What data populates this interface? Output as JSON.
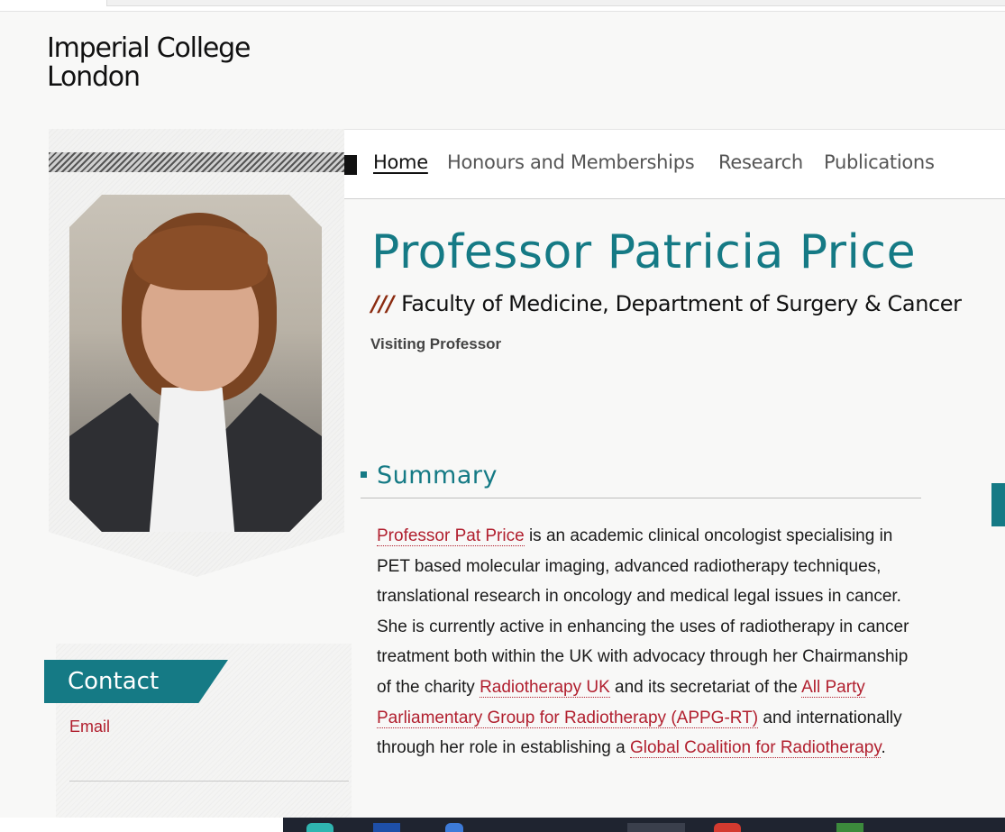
{
  "logo": {
    "line1": "Imperial College",
    "line2": "London"
  },
  "nav": {
    "items": [
      {
        "label": "Home",
        "active": true
      },
      {
        "label": "Honours and Memberships",
        "active": false
      },
      {
        "label": "Research",
        "active": false
      },
      {
        "label": "Publications",
        "active": false
      }
    ]
  },
  "profile": {
    "name": "Professor Patricia Price",
    "faculty_prefix": "///",
    "faculty": "Faculty of Medicine, Department of Surgery & Cancer",
    "role": "Visiting Professor"
  },
  "summary": {
    "heading": "Summary",
    "text_1_link": "Professor Pat Price",
    "text_2": " is an academic clinical oncologist specialising in PET based molecular imaging, advanced radiotherapy techniques, translational research in oncology and medical legal issues in cancer. She is currently active in enhancing the uses of radiotherapy in cancer treatment both within the UK with advocacy through her Chairmanship of the charity ",
    "text_3_link": "Radiotherapy UK",
    "text_4": " and its secretariat of the ",
    "text_5_link": "All Party Parliamentary Group for Radiotherapy (APPG-RT)",
    "text_6": " and internationally through her role in establishing a ",
    "text_7_link": "Global Coalition for Radiotherapy",
    "text_8": "."
  },
  "contact": {
    "heading": "Contact",
    "email_label": "Email"
  },
  "colors": {
    "accent": "#157a85",
    "link": "#b11f2e",
    "slash": "#8b2b10"
  }
}
